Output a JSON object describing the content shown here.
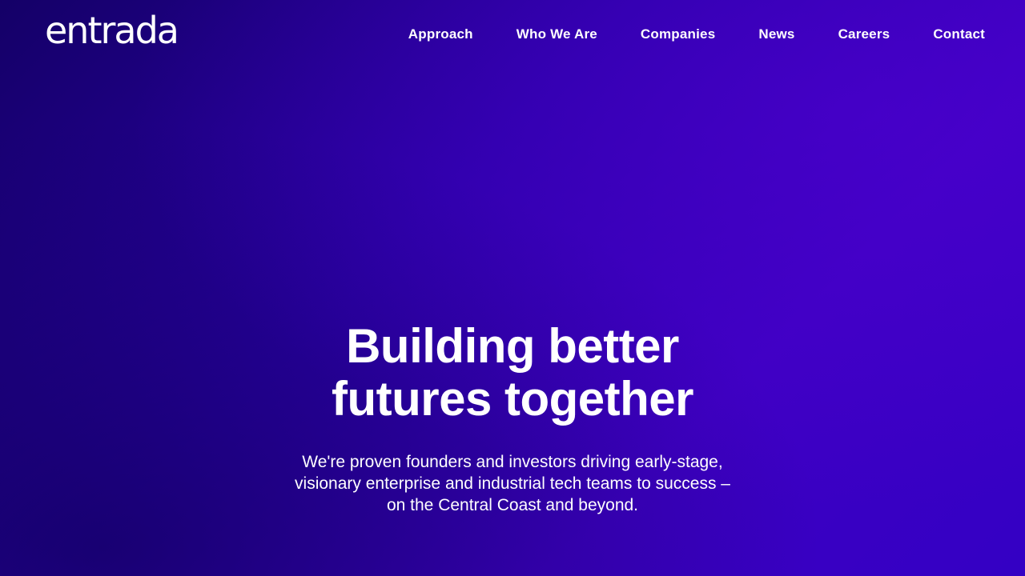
{
  "header": {
    "logo_text": "entrada",
    "nav": [
      {
        "label": "Approach"
      },
      {
        "label": "Who We Are"
      },
      {
        "label": "Companies"
      },
      {
        "label": "News"
      },
      {
        "label": "Careers"
      },
      {
        "label": "Contact"
      }
    ]
  },
  "hero": {
    "headline": "Building better futures together",
    "subtitle": "We're proven founders and investors driving early-stage, visionary enterprise and industrial tech teams to success – on the Central Coast and beyond."
  },
  "colors": {
    "background_start": "#140067",
    "background_end": "#3d00c2",
    "text": "#ffffff"
  }
}
